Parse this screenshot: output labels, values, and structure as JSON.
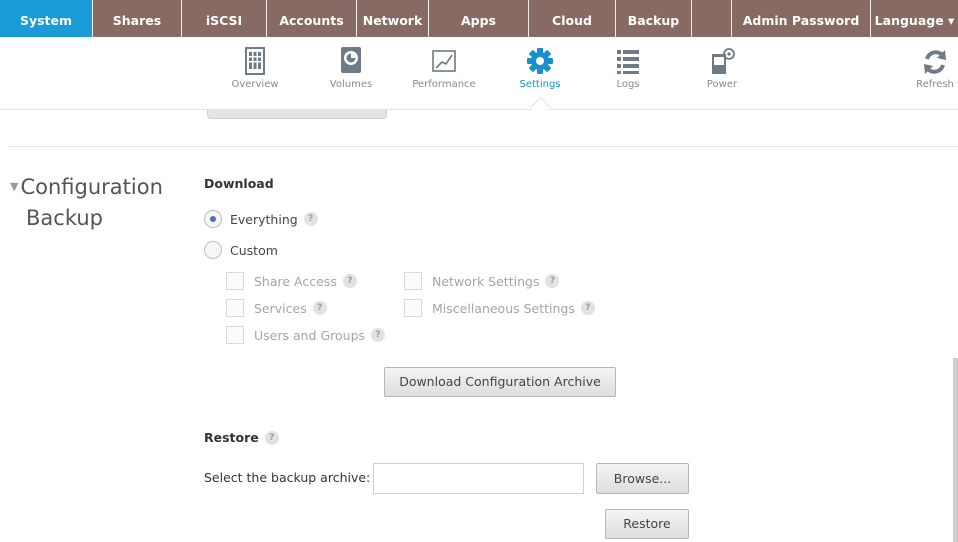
{
  "topnav": {
    "tabs": [
      {
        "label": "System",
        "active": true
      },
      {
        "label": "Shares"
      },
      {
        "label": "iSCSI"
      },
      {
        "label": "Accounts"
      },
      {
        "label": "Network"
      },
      {
        "label": "Apps"
      },
      {
        "label": "Cloud"
      },
      {
        "label": "Backup"
      },
      {
        "label": ""
      },
      {
        "label": "Admin Password"
      },
      {
        "label": "Language ▾"
      }
    ],
    "colors": {
      "bar": "#866a63",
      "active": "#1a9ad6"
    }
  },
  "toolbar": {
    "items": [
      {
        "label": "Overview",
        "icon": "overview-icon"
      },
      {
        "label": "Volumes",
        "icon": "volumes-icon"
      },
      {
        "label": "Performance",
        "icon": "performance-icon"
      },
      {
        "label": "Settings",
        "icon": "gear-icon",
        "active": true
      },
      {
        "label": "Logs",
        "icon": "logs-icon"
      },
      {
        "label": "Power",
        "icon": "power-icon"
      },
      {
        "label": "Refresh",
        "icon": "refresh-icon"
      }
    ]
  },
  "section": {
    "title_line1": "Configuration",
    "title_line2": "Backup"
  },
  "download": {
    "heading": "Download",
    "everything_label": "Everything",
    "custom_label": "Custom",
    "selected": "Everything",
    "options": {
      "share_access": "Share Access",
      "services": "Services",
      "users_and_groups": "Users and Groups",
      "network_settings": "Network Settings",
      "misc_settings": "Miscellaneous Settings"
    },
    "button_label": "Download Configuration Archive"
  },
  "restore": {
    "heading": "Restore",
    "select_label": "Select the backup archive:",
    "file_value": "",
    "browse_label": "Browse...",
    "restore_label": "Restore"
  },
  "help_glyph": "?"
}
